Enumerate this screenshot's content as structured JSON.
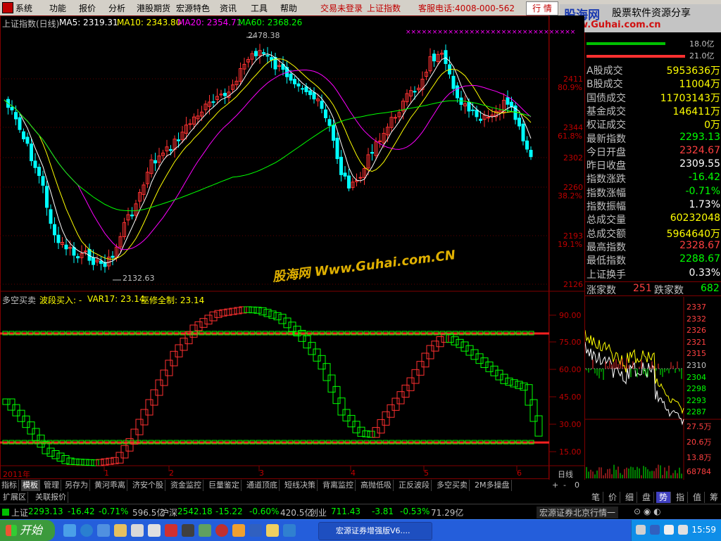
{
  "menu": {
    "items": [
      "系统",
      "功能",
      "报价",
      "分析",
      "港股期货",
      "宏源特色",
      "资讯",
      "工具",
      "帮助"
    ],
    "login_status": "交易未登录",
    "current_index": "上证指数",
    "service_phone": "客服电话:4008-000-562",
    "quote_button": "行 情"
  },
  "logo": {
    "brand": "股海网",
    "slogan": "股票软件资源分享",
    "url": "www.Guhai.com.cn"
  },
  "watermark": "股海网 Www.Guhai.com.CN",
  "main_chart": {
    "header": {
      "title": "上证指数(日线)",
      "ma5": "MA5: 2319.31",
      "ma10": "MA10: 2343.80",
      "ma20": "MA20: 2354.71",
      "ma60": "MA60: 2368.26"
    },
    "high_label": "2478.38",
    "low_label": "2132.63",
    "y_ticks": [
      {
        "v": "2411",
        "p": "80.9%"
      },
      {
        "v": "2344",
        "p": "61.8%"
      },
      {
        "v": "2302",
        "p": ""
      },
      {
        "v": "2260",
        "p": "38.2%"
      },
      {
        "v": "2193",
        "p": "19.1%"
      },
      {
        "v": "2126",
        "p": ""
      }
    ],
    "colors": {
      "ma5": "#ffffff",
      "ma10": "#ffff00",
      "ma20": "#ff00ff",
      "ma60": "#00ff00",
      "up": "#ff3232",
      "down": "#00ffff"
    }
  },
  "indicator": {
    "header": {
      "name": "多空买卖",
      "buy_label": "波段买入: -",
      "var17": "VAR17: 23.14",
      "wuxiu": "巫修全制: 23.14"
    },
    "y_ticks": [
      "90.00",
      "75.00",
      "60.00",
      "45.00",
      "30.00",
      "15.00"
    ]
  },
  "x_axis": {
    "labels": [
      "2011年",
      "1",
      "2",
      "3",
      "4",
      "5",
      "6"
    ],
    "period": "日线"
  },
  "right_panel": {
    "bar_top": "18.0亿",
    "bar_bottom": "21.0亿",
    "rows": [
      {
        "label": "A股成交",
        "value": "5953636万",
        "color": "yellow"
      },
      {
        "label": "B股成交",
        "value": "11004万",
        "color": "yellow"
      },
      {
        "label": "国债成交",
        "value": "11703143万",
        "color": "yellow"
      },
      {
        "label": "基金成交",
        "value": "146411万",
        "color": "yellow"
      },
      {
        "label": "权证成交",
        "value": "0万",
        "color": "yellow"
      },
      {
        "label": "最新指数",
        "value": "2293.13",
        "color": "green"
      },
      {
        "label": "今日开盘",
        "value": "2324.67",
        "color": "red"
      },
      {
        "label": "昨日收盘",
        "value": "2309.55",
        "color": "white"
      },
      {
        "label": "指数涨跌",
        "value": "-16.42",
        "color": "green"
      },
      {
        "label": "指数涨幅",
        "value": "-0.71%",
        "color": "green"
      },
      {
        "label": "指数振幅",
        "value": "1.73%",
        "color": "white"
      },
      {
        "label": "总成交量",
        "value": "60232048",
        "color": "yellow"
      },
      {
        "label": "总成交额",
        "value": "5964640万",
        "color": "yellow"
      },
      {
        "label": "最高指数",
        "value": "2328.67",
        "color": "red"
      },
      {
        "label": "最低指数",
        "value": "2288.67",
        "color": "green"
      },
      {
        "label": "上证换手",
        "value": "0.33%",
        "color": "white"
      }
    ],
    "rise_label": "涨家数",
    "rise_value": "251",
    "fall_label": "跌家数",
    "fall_value": "682",
    "mini_y": [
      "2337",
      "2332",
      "2326",
      "2321",
      "2315",
      "2310",
      "2304",
      "2298",
      "2293",
      "2287"
    ],
    "mini_vol": [
      "27.5万",
      "20.6万",
      "13.8万",
      "68784"
    ],
    "tabs": [
      "笔",
      "价",
      "细",
      "盘",
      "势",
      "指",
      "值",
      "筹"
    ],
    "active_tab": "势"
  },
  "bottom_tabs": {
    "row1": [
      "指标",
      "模板",
      "管理",
      "另存为",
      "黄河乖离",
      "济安个股",
      "资金监控",
      "巨量鉴定",
      "通道顶底",
      "短线决策",
      "背离监控",
      "高抛低吸",
      "正反波段",
      "多空买卖",
      "2M多操盘"
    ],
    "row2": [
      "扩展区",
      "关联报价"
    ],
    "controls": [
      "+",
      "-",
      "0"
    ]
  },
  "ticker": {
    "sh_name": "上证",
    "sh_value": "2293.13",
    "sh_change": "-16.42",
    "sh_pct": "-0.71%",
    "sh_amt": "596.5亿",
    "hs_name": "沪深",
    "hs_value": "2542.18",
    "hs_change": "-15.22",
    "hs_pct": "-0.60%",
    "hs_amt": "420.5亿",
    "cy_name": "创业",
    "cy_value": "711.43",
    "cy_change": "-3.81",
    "cy_pct": "-0.53%",
    "cy_amt": "71.29亿",
    "broker": "宏源证券北京行情一"
  },
  "taskbar": {
    "start": "开始",
    "task": "宏源证券增强版V6....",
    "clock": "15:59"
  }
}
